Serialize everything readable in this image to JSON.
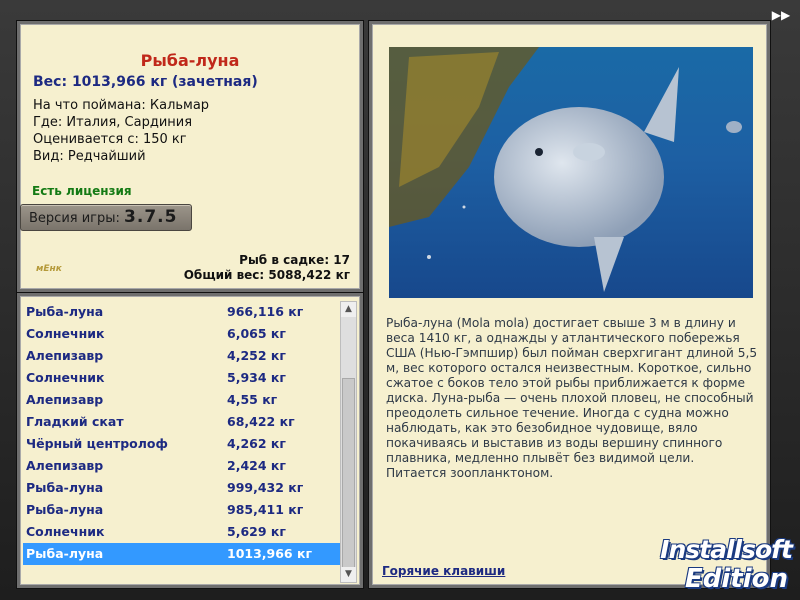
{
  "catch": {
    "title": "Рыба-луна",
    "weight": "Вес: 1013,966 кг (зачетная)",
    "bait": "На что поймана: Кальмар",
    "location": "Где: Италия, Сардиния",
    "value": "Оценивается с: 150 кг",
    "rarity": "Вид: Редчайший",
    "license": "Есть лицензия"
  },
  "version": {
    "label": "Версия игры:",
    "number": "3.7.5"
  },
  "keepnet": {
    "count": "Рыб в садке: 17",
    "total": "Общий вес: 5088,422 кг"
  },
  "small_logo": "мЕнк",
  "list": [
    {
      "name": "Рыба-луна",
      "weight": "966,116 кг",
      "selected": false
    },
    {
      "name": "Солнечник",
      "weight": "6,065 кг",
      "selected": false
    },
    {
      "name": "Алепизавр",
      "weight": "4,252 кг",
      "selected": false
    },
    {
      "name": "Солнечник",
      "weight": "5,934 кг",
      "selected": false
    },
    {
      "name": "Алепизавр",
      "weight": "4,55 кг",
      "selected": false
    },
    {
      "name": "Гладкий скат",
      "weight": "68,422 кг",
      "selected": false
    },
    {
      "name": "Чёрный центролоф",
      "weight": "4,262 кг",
      "selected": false
    },
    {
      "name": "Алепизавр",
      "weight": "2,424 кг",
      "selected": false
    },
    {
      "name": "Рыба-луна",
      "weight": "999,432 кг",
      "selected": false
    },
    {
      "name": "Рыба-луна",
      "weight": "985,411 кг",
      "selected": false
    },
    {
      "name": "Солнечник",
      "weight": "5,629 кг",
      "selected": false
    },
    {
      "name": "Рыба-луна",
      "weight": "1013,966 кг",
      "selected": true
    }
  ],
  "description": "Рыба-луна (Mola mola) достигает свыше 3 м в длину и веса 1410 кг, а однажды у атлантического побережья США (Нью-Гэмпшир) был пойман сверхгигант длиной 5,5 м, вес которого остался неизвестным. Короткое, сильно сжатое с боков тело этой рыбы приближается к форме диска. Луна-рыба — очень плохой пловец, не способный преодолеть сильное течение. Иногда с судна можно наблюдать, как это безобидное чудовище, вяло покачиваясь и выставив из воды вершину спинного плавника, медленно плывёт без видимой цели. Питается зоопланктоном.",
  "hotkeys_link": "Горячие клавиши",
  "brand": {
    "line1": "Installsoft",
    "line2": "Edition"
  },
  "icons": {
    "forward": "fast-forward-icon",
    "scroll_up": "chevron-up-icon",
    "scroll_down": "chevron-down-icon"
  },
  "colors": {
    "title_red": "#c0281a",
    "navy": "#1d2a82",
    "license_green": "#147a14",
    "selection": "#3399ff",
    "panel_bg": "#f6f0cf"
  }
}
